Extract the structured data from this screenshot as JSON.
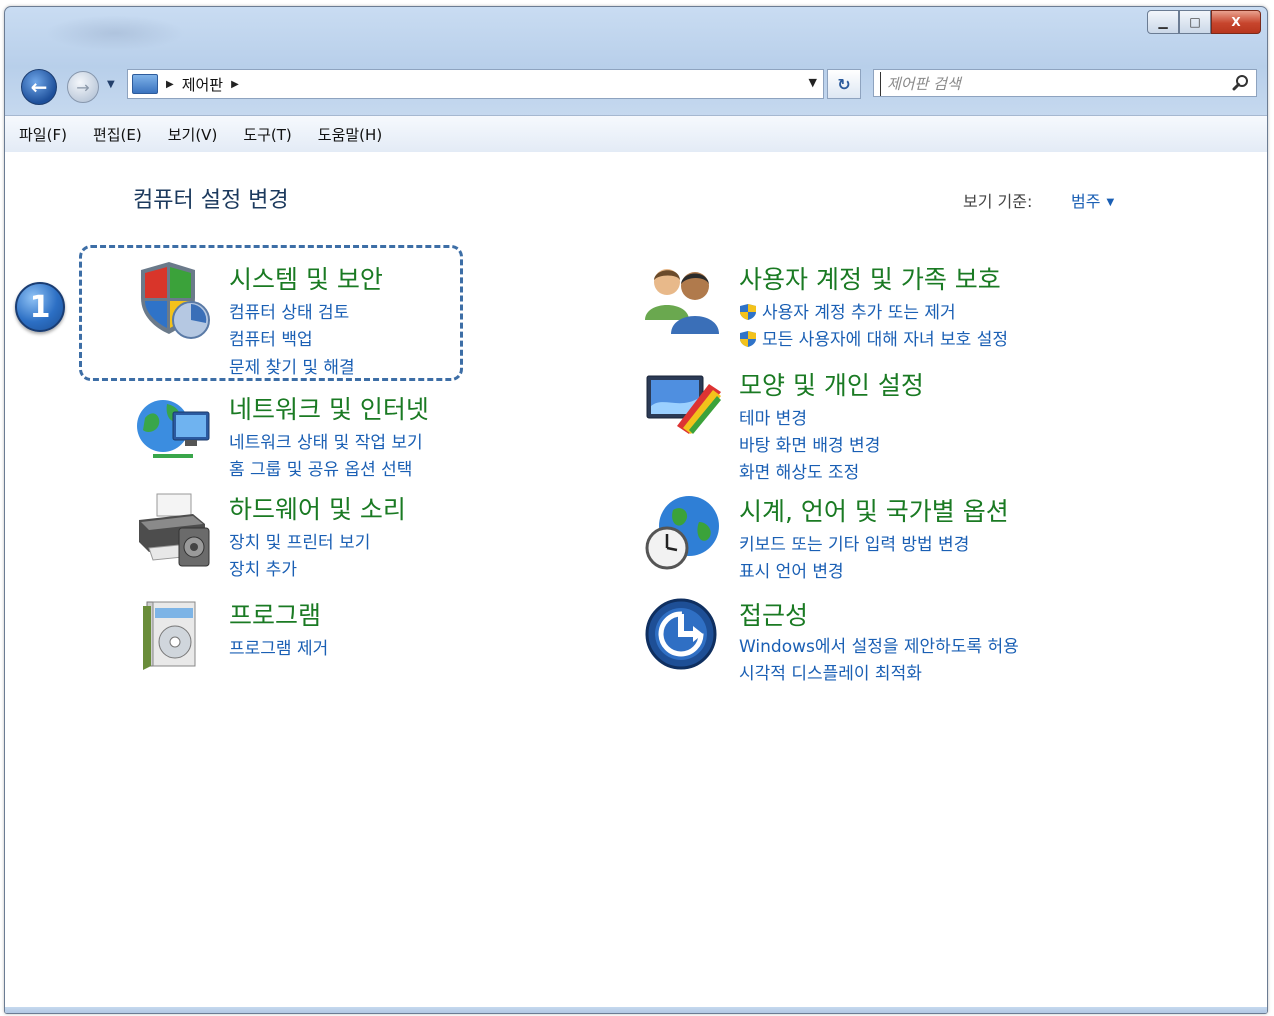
{
  "window": {
    "controls": {
      "minimize": "▁",
      "maximize": "□",
      "close": "X"
    }
  },
  "navbar": {
    "back_glyph": "←",
    "forward_glyph": "→",
    "history_dropdown_glyph": "▼",
    "breadcrumb_arrow": "▶",
    "breadcrumb": [
      "제어판"
    ],
    "address_dropdown_glyph": "▼",
    "refresh_glyph": "↻",
    "search_placeholder": "제어판 검색"
  },
  "menubar": {
    "items": [
      "파일(F)",
      "편집(E)",
      "보기(V)",
      "도구(T)",
      "도움말(H)"
    ]
  },
  "content": {
    "title": "컴퓨터 설정 변경",
    "view_by_label": "보기 기준:",
    "view_by_value": "범주",
    "view_by_arrow": "▼",
    "callout_number": "1",
    "categories": [
      {
        "title": "시스템 및 보안",
        "icon": "shield-icon",
        "links": [
          "컴퓨터 상태 검토",
          "컴퓨터 백업",
          "문제 찾기 및 해결"
        ]
      },
      {
        "title": "네트워크 및 인터넷",
        "icon": "network-icon",
        "links": [
          "네트워크 상태 및 작업 보기",
          "홈 그룹 및 공유 옵션 선택"
        ]
      },
      {
        "title": "하드웨어 및 소리",
        "icon": "printer-icon",
        "links": [
          "장치 및 프린터 보기",
          "장치 추가"
        ]
      },
      {
        "title": "프로그램",
        "icon": "programs-icon",
        "links": [
          "프로그램 제거"
        ]
      },
      {
        "title": "사용자 계정 및 가족 보호",
        "icon": "users-icon",
        "links": [
          "사용자 계정 추가 또는 제거",
          "모든 사용자에 대해 자녀 보호 설정"
        ]
      },
      {
        "title": "모양 및 개인 설정",
        "icon": "appearance-icon",
        "links": [
          "테마 변경",
          "바탕 화면 배경 변경",
          "화면 해상도 조정"
        ]
      },
      {
        "title": "시계, 언어 및 국가별 옵션",
        "icon": "clock-globe-icon",
        "links": [
          "키보드 또는 기타 입력 방법 변경",
          "표시 언어 변경"
        ]
      },
      {
        "title": "접근성",
        "icon": "accessibility-icon",
        "links": [
          "Windows에서 설정을 제안하도록 허용",
          "시각적 디스플레이 최적화"
        ]
      }
    ]
  },
  "colors": {
    "category_title": "#1a7a23",
    "link": "#1a5fb4",
    "highlight_border": "#3d6ea6"
  }
}
